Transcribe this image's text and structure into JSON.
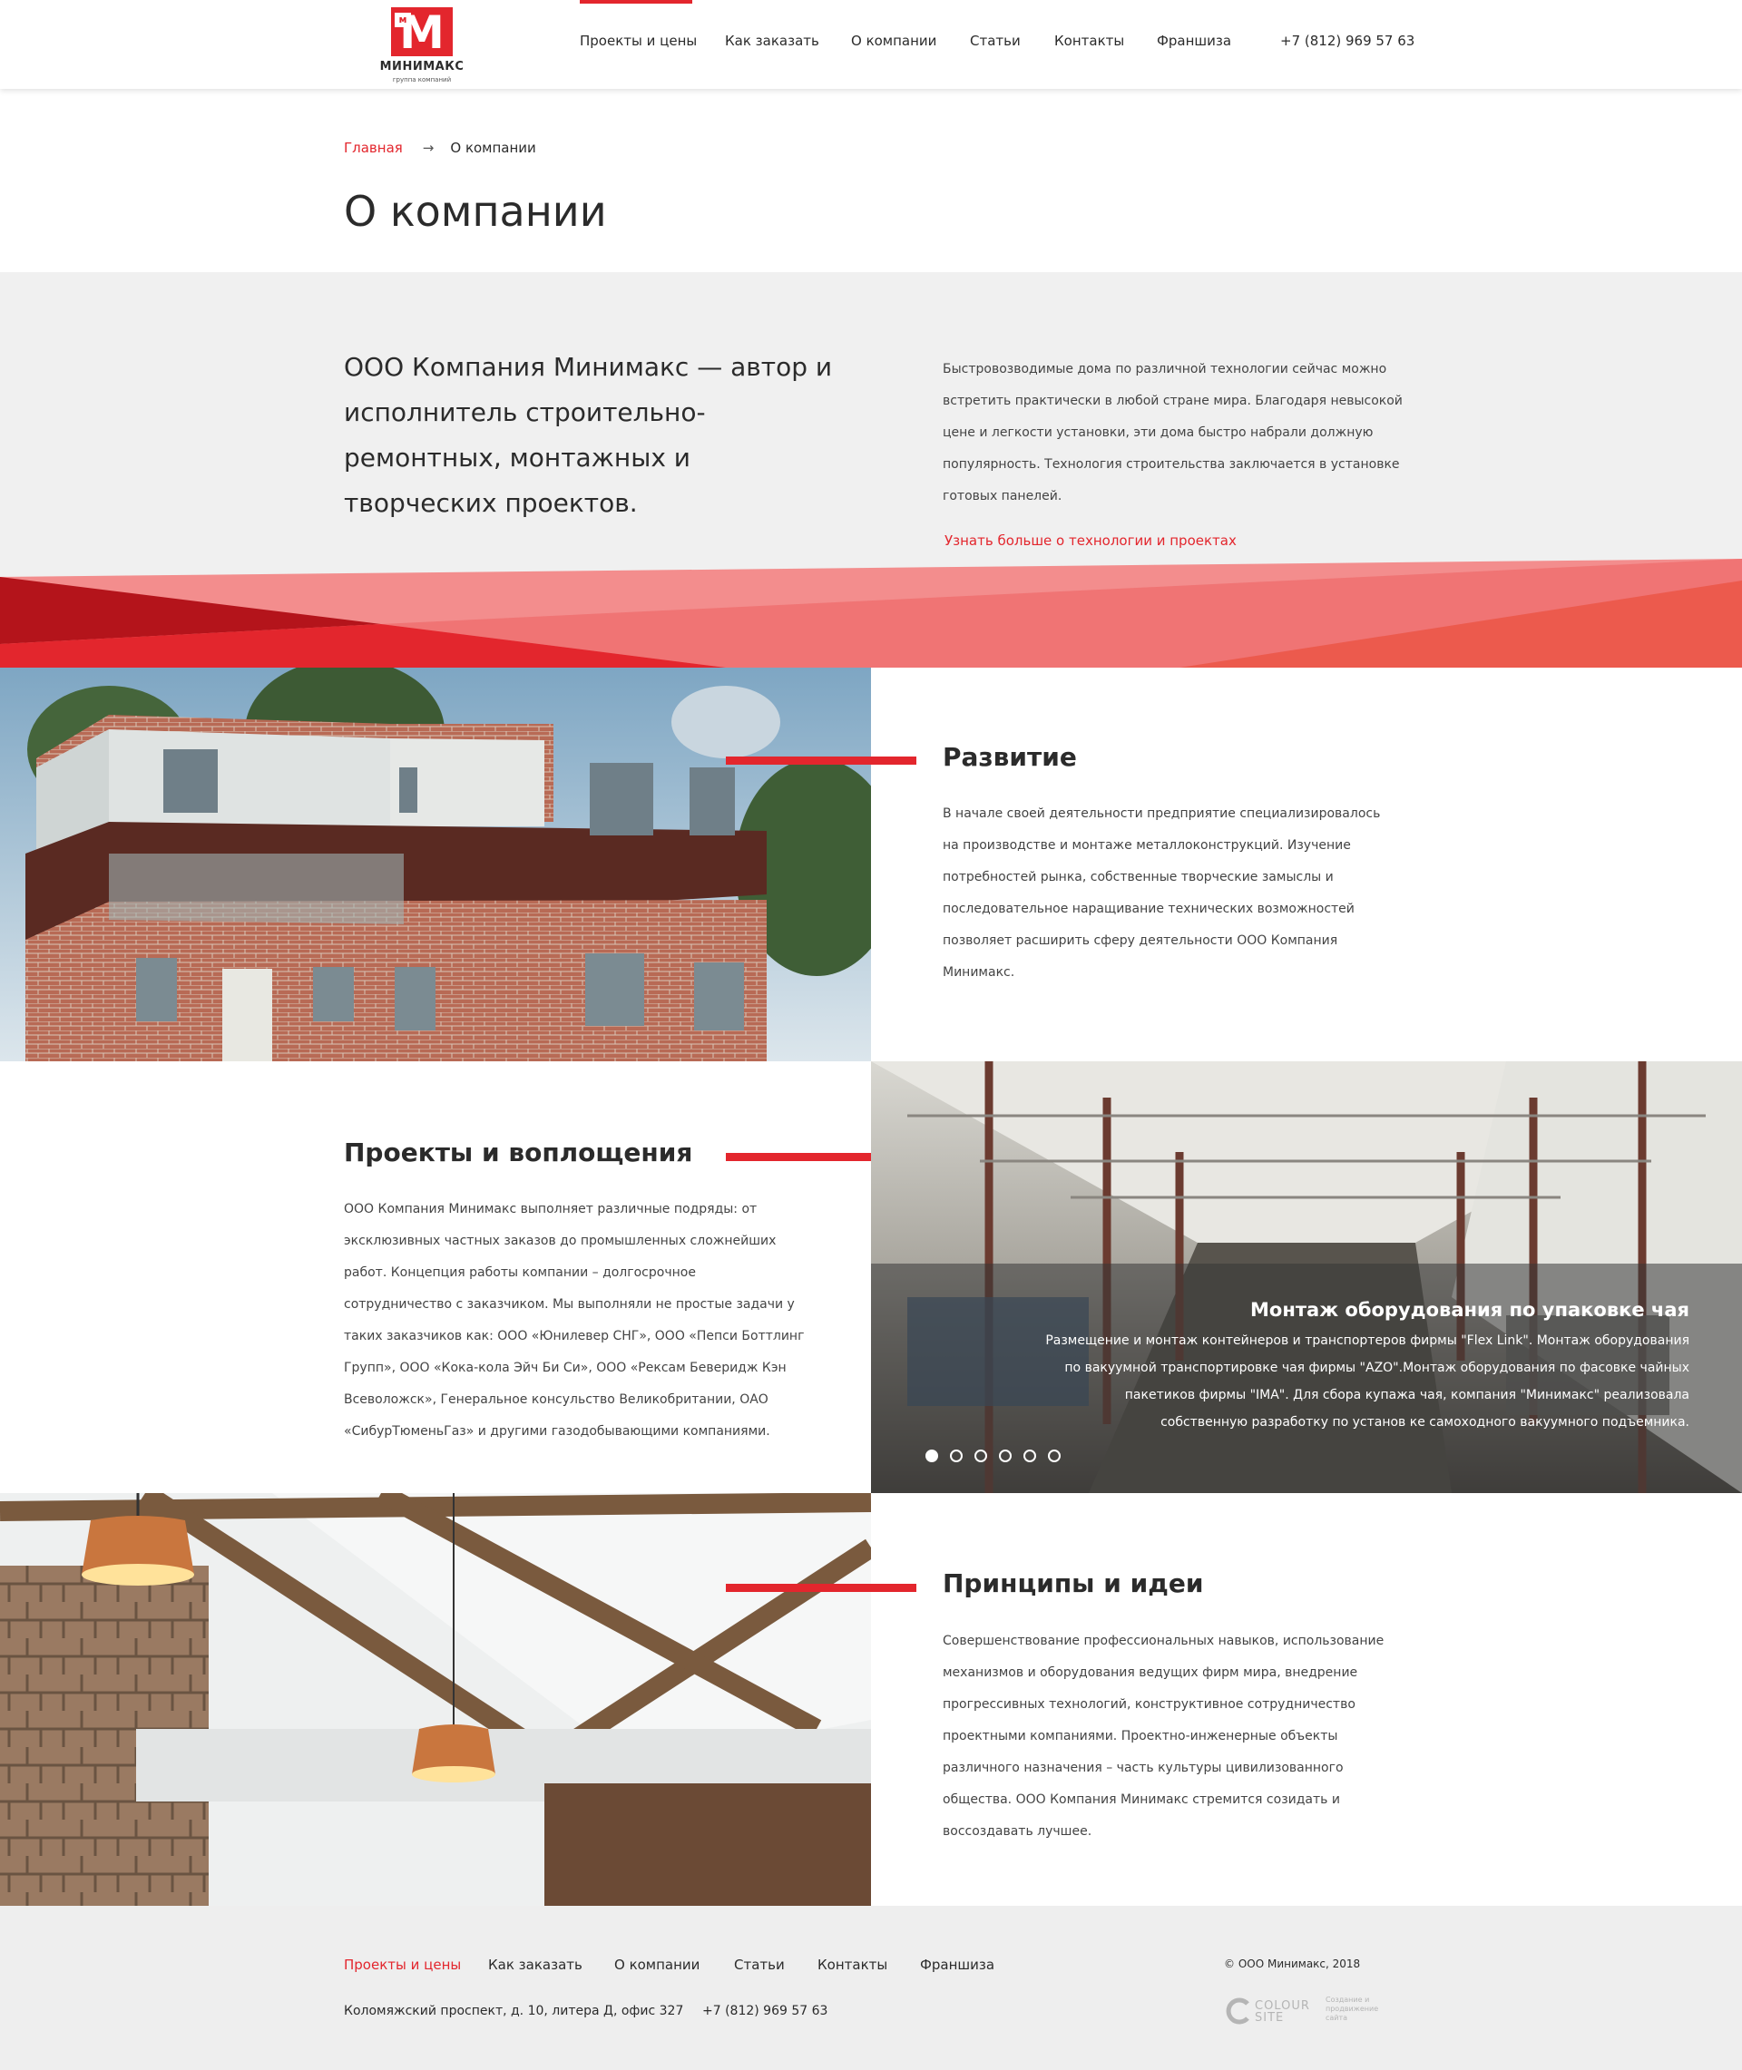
{
  "header": {
    "logo": {
      "mark_small": "м",
      "mark_big": "М",
      "name": "МИНИМАКС",
      "subtitle": "группа компаний"
    },
    "nav": [
      {
        "label": "Проекты и цены",
        "active": true
      },
      {
        "label": "Как заказать",
        "active": false
      },
      {
        "label": "О компании",
        "active": false
      },
      {
        "label": "Статьи",
        "active": false
      },
      {
        "label": "Контакты",
        "active": false
      },
      {
        "label": "Франшиза",
        "active": false
      }
    ],
    "phone": "+7 (812) 969 57 63"
  },
  "breadcrumb": {
    "home": "Главная",
    "arrow": "→",
    "current": "О компании"
  },
  "page_title": "О компании",
  "intro": {
    "lead": "ООО Компания Минимакс — автор и исполнитель строительно-ремонтных, монтажных и творческих проектов.",
    "text": "Быстровозводимые дома по различной технологии сейчас можно встретить практически в любой стране мира. Благодаря невысокой цене и легкости установки, эти дома быстро набрали должную популярность. Технология строительства заключается в установке готовых панелей.",
    "link": "Узнать больше о технологии и проектах"
  },
  "sections": {
    "development": {
      "title": "Развитие",
      "text": "В начале своей деятельности предприятие специализировалось на производстве и монтаже металлоконструкций. Изучение потребностей рынка, собственные творческие замыслы и последовательное наращивание технических возможностей позволяет расширить сферу деятельности ООО Компания Минимакс."
    },
    "projects": {
      "title": "Проекты и воплощения",
      "text": "ООО Компания Минимакс выполняет различные подряды: от эксклюзивных частных заказов до промышленных сложнейших работ. Концепция работы компании – долгосрочное сотрудничество с заказчиком. Мы выполняли не простые задачи у таких заказчиков как: ООО «Юнилевер СНГ», ООО «Пепси Боттлинг Групп», ООО «Кока-кола Эйч Би Си», ООО «Рексам Беверидж Кэн Всеволожск», Генеральное консульство Великобритании, ОАО «СибурТюменьГаз» и другими газодобывающими компаниями."
    },
    "principles": {
      "title": "Принципы и идеи",
      "text": "Совершенствование профессиональных навыков, использование механизмов и оборудования ведущих фирм мира, внедрение прогрессивных технологий, конструктивное сотрудничество проектными компаниями. Проектно-инженерные объекты различного назначения – часть культуры цивилизованного общества. ООО Компания Минимакс стремится созидать и воссоздавать лучшее."
    }
  },
  "slider": {
    "title": "Монтаж оборудования по упаковке чая",
    "text": "Размещение и монтаж контейнеров и транспортеров фирмы \"Flex Link\". Монтаж оборудования по вакуумной транспортировке чая фирмы \"AZO\".Монтаж оборудования по фасовке чайных пакетиков фирмы \"IMA\". Для сбора купажа чая, компания \"Минимакс\" реализовала собственную разработку по установ ке самоходного вакуумного подъемника.",
    "slide_count": 6,
    "active_index": 0
  },
  "footer": {
    "nav": [
      {
        "label": "Проекты и цены",
        "active": true
      },
      {
        "label": "Как заказать",
        "active": false
      },
      {
        "label": "О компании",
        "active": false
      },
      {
        "label": "Статьи",
        "active": false
      },
      {
        "label": "Контакты",
        "active": false
      },
      {
        "label": "Франшиза",
        "active": false
      }
    ],
    "address": "Коломяжский проспект, д. 10, литера Д, офис 327",
    "phone": "+7 (812) 969 57 63",
    "copyright": "© ООО Минимакс, 2018",
    "developer": {
      "name_line1": "COLOUR",
      "name_line2": "SITE",
      "desc": "Создание и продвижение сайта"
    }
  },
  "colors": {
    "accent": "#e3262d",
    "grey_band": "#f0f0f0",
    "footer_bg": "#eeeeee"
  }
}
